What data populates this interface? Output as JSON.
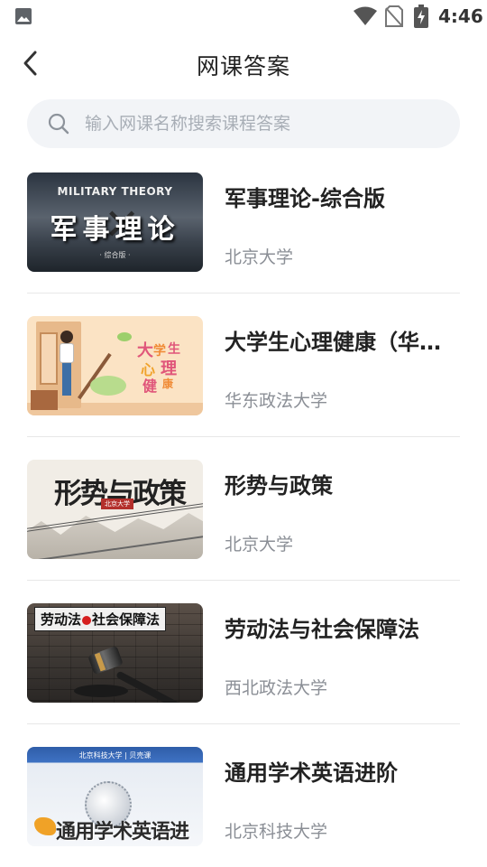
{
  "status_bar": {
    "time": "4:46"
  },
  "header": {
    "title": "网课答案"
  },
  "search": {
    "placeholder": "输入网课名称搜索课程答案",
    "value": ""
  },
  "courses": [
    {
      "title": "军事理论-综合版",
      "school": "北京大学",
      "thumb": {
        "en": "MILITARY THEORY",
        "cn": "军事理论",
        "sub": "· 综合版 ·"
      }
    },
    {
      "title": "大学生心理健康（华东...",
      "school": "华东政法大学",
      "thumb": {
        "chars": [
          "大",
          "学",
          "生",
          "心",
          "理",
          "健",
          "康"
        ]
      }
    },
    {
      "title": "形势与政策",
      "school": "北京大学",
      "thumb": {
        "cn": "形势与政策",
        "tag": "北京大学"
      }
    },
    {
      "title": "劳动法与社会保障法",
      "school": "西北政法大学",
      "thumb": {
        "left": "劳动法",
        "right": "社会保障法"
      }
    },
    {
      "title": "通用学术英语进阶",
      "school": "北京科技大学",
      "thumb": {
        "header": "北京科技大学 | 贝壳课",
        "cn": "通用学术英语进阶"
      }
    }
  ],
  "colors": {
    "search_bg": "#f2f4f7",
    "placeholder": "#a8aeb6",
    "school_text": "#8b8f96",
    "divider": "#e8e8e8"
  }
}
